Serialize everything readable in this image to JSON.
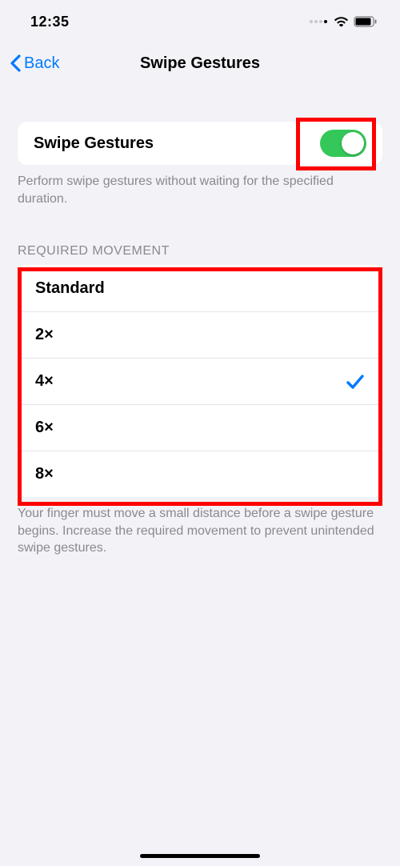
{
  "status": {
    "time": "12:35"
  },
  "nav": {
    "back_label": "Back",
    "title": "Swipe Gestures"
  },
  "toggle_row": {
    "label": "Swipe Gestures",
    "enabled": true,
    "footer": "Perform swipe gestures without waiting for the specified duration."
  },
  "movement_section": {
    "header": "REQUIRED MOVEMENT",
    "options": [
      {
        "label": "Standard",
        "selected": false
      },
      {
        "label": "2×",
        "selected": false
      },
      {
        "label": "4×",
        "selected": true
      },
      {
        "label": "6×",
        "selected": false
      },
      {
        "label": "8×",
        "selected": false
      }
    ],
    "footer": "Your finger must move a small distance before a swipe gesture begins. Increase the required movement to prevent unintended swipe gestures."
  }
}
